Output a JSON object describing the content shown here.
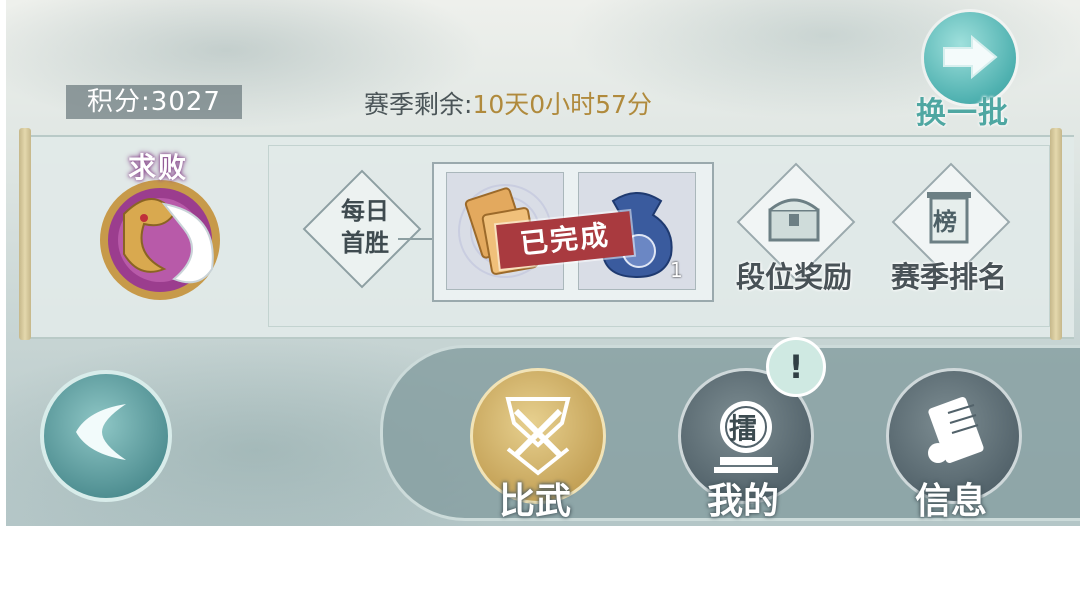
{
  "header": {
    "score_label": "积分:3027",
    "season_prefix": "赛季剩余:",
    "season_remaining": "10天0小时57分",
    "refresh_label": "换一批"
  },
  "rank": {
    "name": "求败"
  },
  "daily": {
    "label_line1": "每日",
    "label_line2": "首胜",
    "status": "已完成",
    "reward_count": "1"
  },
  "side_buttons": {
    "rank_reward": "段位奖励",
    "season_rank": "赛季排名",
    "season_rank_glyph": "榜"
  },
  "nav": {
    "duel": "比武",
    "mine": "我的",
    "mine_glyph": "擂",
    "info": "信息",
    "alert": "!"
  },
  "colors": {
    "accent_teal": "#4fb1b0",
    "gold": "#c3a055",
    "stamp_red": "#a93a3f"
  }
}
